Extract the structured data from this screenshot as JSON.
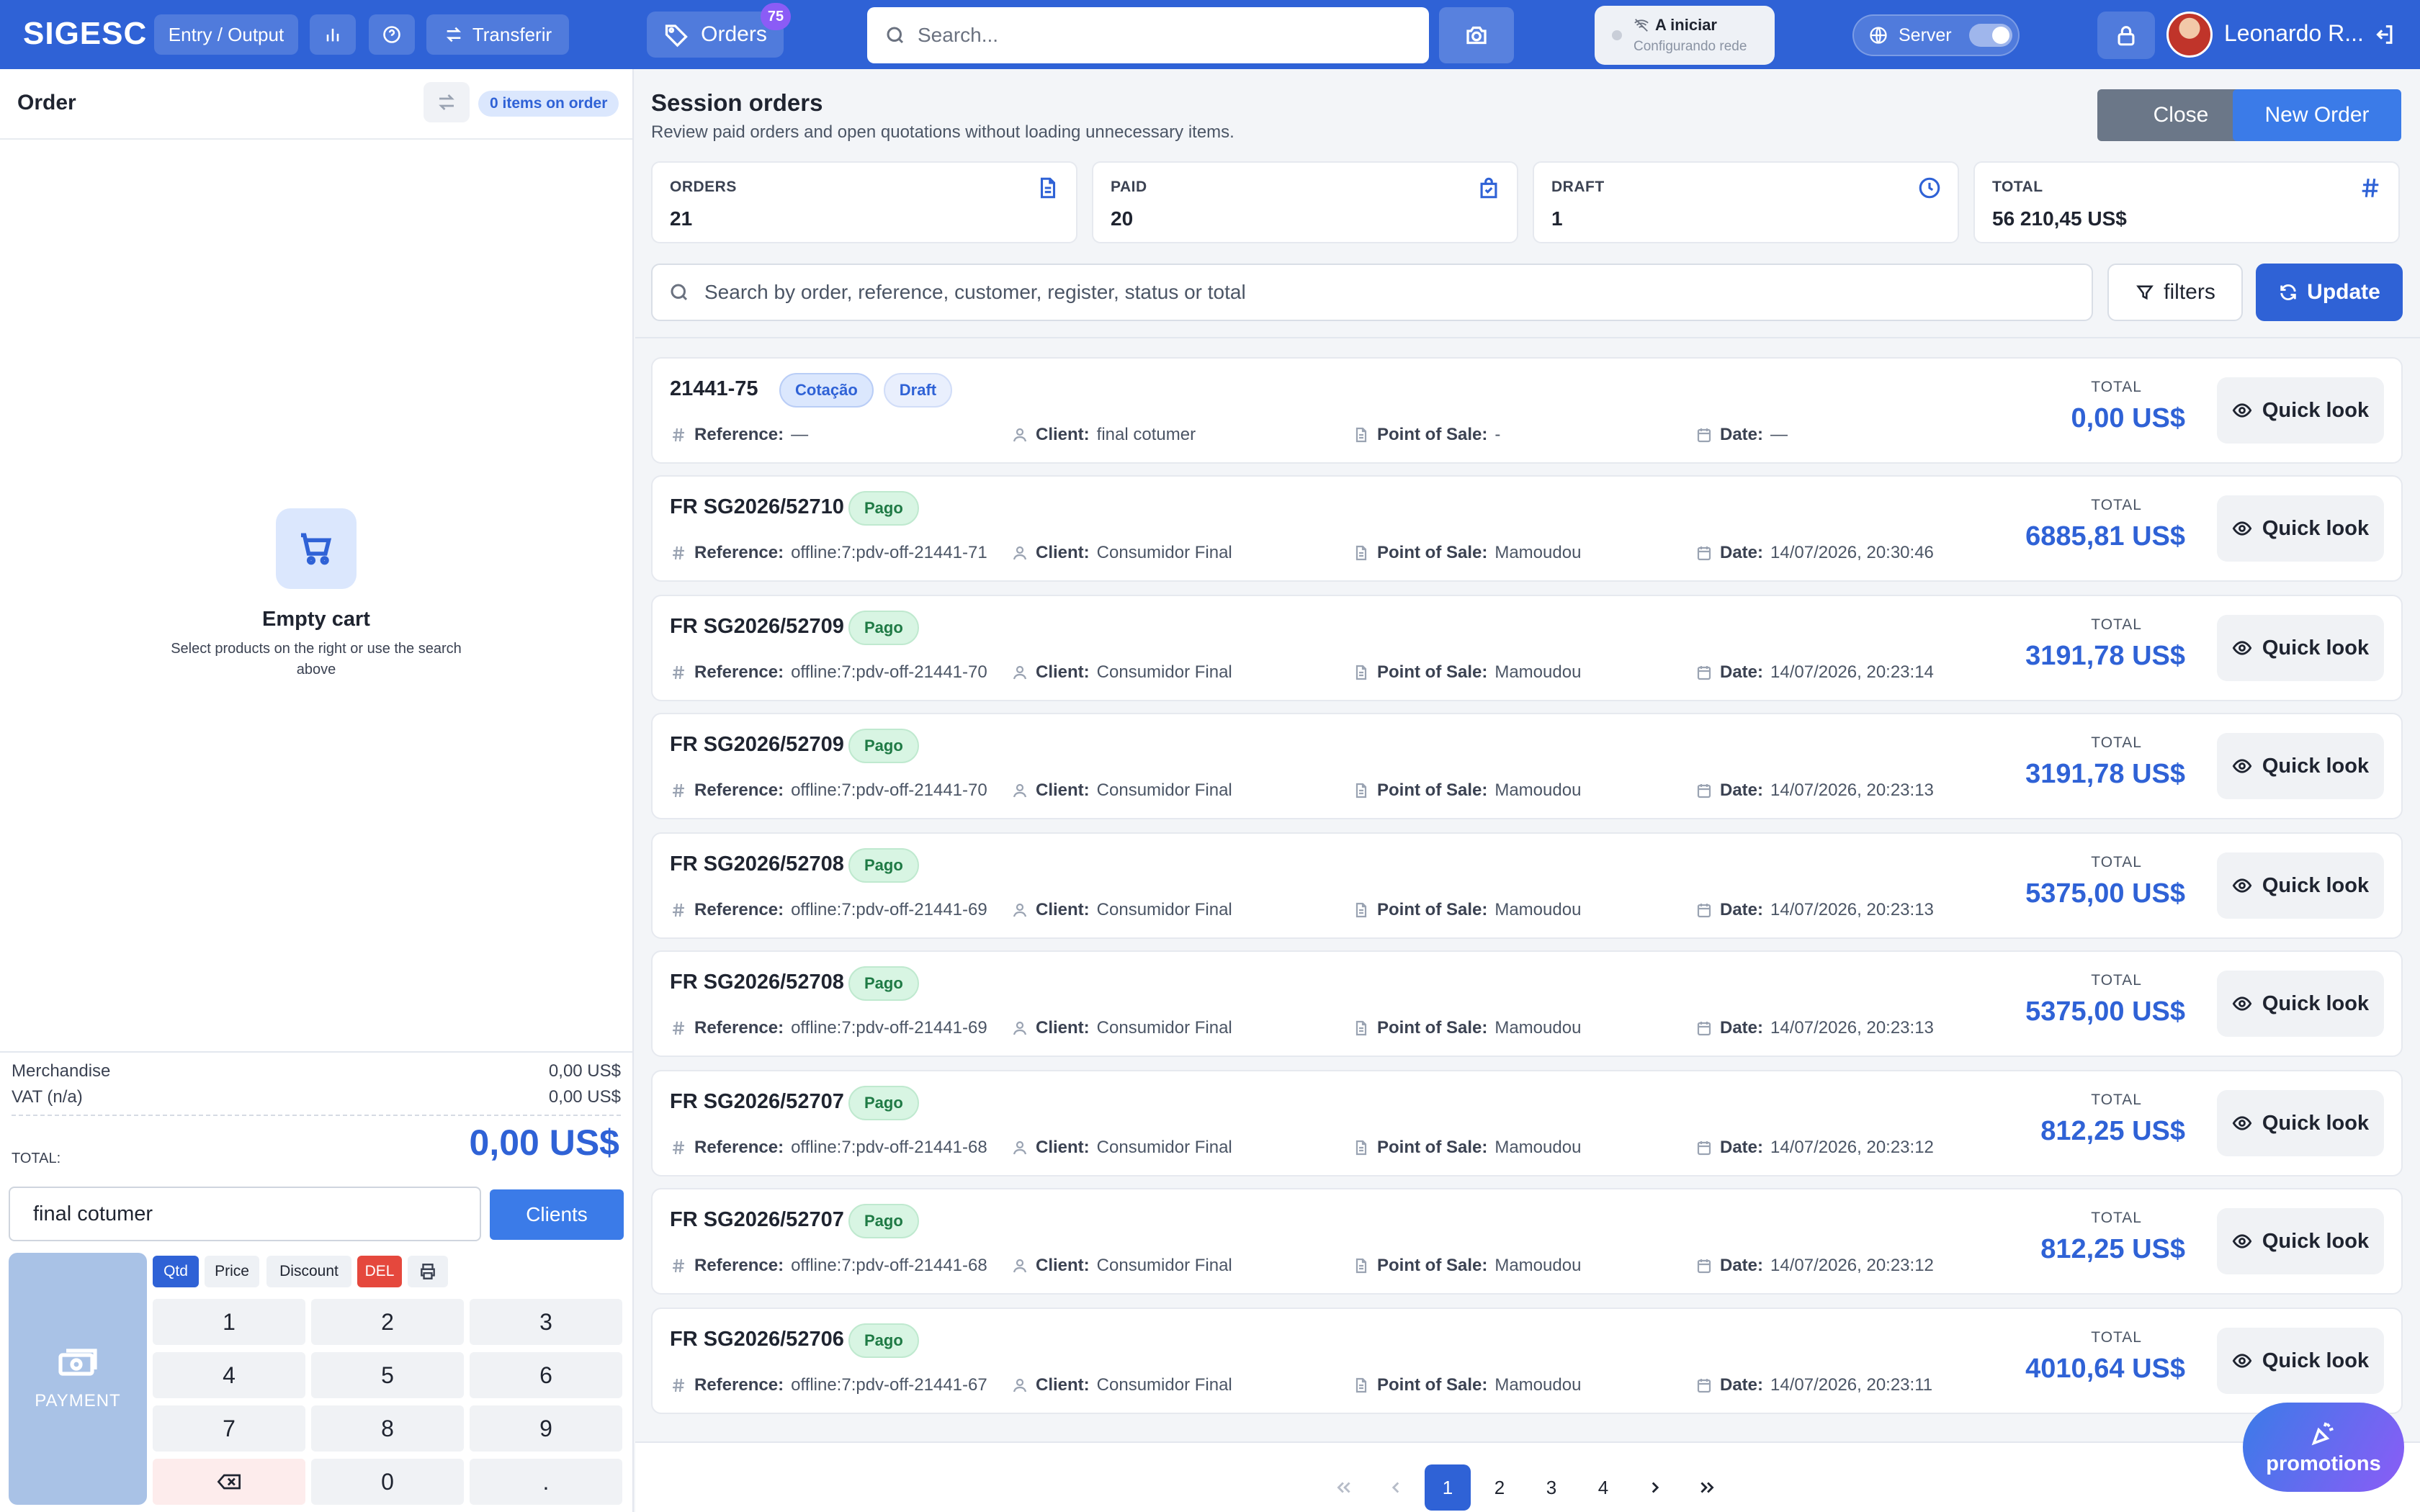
{
  "app": {
    "logo": "SIGESC",
    "nav": {
      "entry_output": "Entry / Output",
      "transfer": "Transferir",
      "orders": "Orders",
      "orders_count": "75"
    },
    "search_placeholder": "Search...",
    "network": {
      "title": "A iniciar",
      "subtitle": "Configurando rede"
    },
    "server_label": "Server",
    "user_name": "Leonardo R..."
  },
  "left": {
    "title": "Order",
    "items_badge": "0 items on order",
    "empty_title": "Empty cart",
    "empty_sub": "Select products on the right or use the search above",
    "merch_label": "Merchandise",
    "merch_value": "0,00 US$",
    "vat_label": "VAT (n/a)",
    "vat_value": "0,00 US$",
    "total_label": "TOTAL:",
    "total_value": "0,00 US$",
    "client_value": "final cotumer",
    "clients_btn": "Clients",
    "payment_label": "PAYMENT",
    "modes": {
      "qtd": "Qtd",
      "price": "Price",
      "discount": "Discount",
      "del": "DEL"
    },
    "keys": [
      "1",
      "2",
      "3",
      "4",
      "5",
      "6",
      "7",
      "8",
      "9",
      "",
      "0",
      "."
    ]
  },
  "main": {
    "title": "Session orders",
    "subtitle": "Review paid orders and open quotations without loading unnecessary items.",
    "close_btn": "Close",
    "new_btn": "New Order",
    "stats": [
      {
        "label": "ORDERS",
        "value": "21",
        "icon": "document-icon"
      },
      {
        "label": "PAID",
        "value": "20",
        "icon": "bag-check-icon"
      },
      {
        "label": "DRAFT",
        "value": "1",
        "icon": "clock-icon"
      },
      {
        "label": "TOTAL",
        "value": "56 210,45 US$",
        "icon": "hash-icon"
      }
    ],
    "filter_placeholder": "Search by order, reference, customer, register, status or total",
    "filters_btn": "filters",
    "update_btn": "Update",
    "ref_label": "Reference:",
    "client_label": "Client:",
    "pos_label": "Point of Sale:",
    "date_label": "Date:",
    "total_label": "TOTAL",
    "quick_label": "Quick look",
    "orders": [
      {
        "id": "21441-75",
        "tags": [
          "Cotação",
          "Draft"
        ],
        "reference": "—",
        "client": "final cotumer",
        "pos": "-",
        "date": "—",
        "total": "0,00 US$"
      },
      {
        "id": "FR SG2026/52710",
        "tags": [
          "Pago"
        ],
        "reference": "offline:7:pdv-off-21441-71",
        "client": "Consumidor Final",
        "pos": "Mamoudou",
        "date": "14/07/2026, 20:30:46",
        "total": "6885,81 US$"
      },
      {
        "id": "FR SG2026/52709",
        "tags": [
          "Pago"
        ],
        "reference": "offline:7:pdv-off-21441-70",
        "client": "Consumidor Final",
        "pos": "Mamoudou",
        "date": "14/07/2026, 20:23:14",
        "total": "3191,78 US$"
      },
      {
        "id": "FR SG2026/52709",
        "tags": [
          "Pago"
        ],
        "reference": "offline:7:pdv-off-21441-70",
        "client": "Consumidor Final",
        "pos": "Mamoudou",
        "date": "14/07/2026, 20:23:13",
        "total": "3191,78 US$"
      },
      {
        "id": "FR SG2026/52708",
        "tags": [
          "Pago"
        ],
        "reference": "offline:7:pdv-off-21441-69",
        "client": "Consumidor Final",
        "pos": "Mamoudou",
        "date": "14/07/2026, 20:23:13",
        "total": "5375,00 US$"
      },
      {
        "id": "FR SG2026/52708",
        "tags": [
          "Pago"
        ],
        "reference": "offline:7:pdv-off-21441-69",
        "client": "Consumidor Final",
        "pos": "Mamoudou",
        "date": "14/07/2026, 20:23:13",
        "total": "5375,00 US$"
      },
      {
        "id": "FR SG2026/52707",
        "tags": [
          "Pago"
        ],
        "reference": "offline:7:pdv-off-21441-68",
        "client": "Consumidor Final",
        "pos": "Mamoudou",
        "date": "14/07/2026, 20:23:12",
        "total": "812,25 US$"
      },
      {
        "id": "FR SG2026/52707",
        "tags": [
          "Pago"
        ],
        "reference": "offline:7:pdv-off-21441-68",
        "client": "Consumidor Final",
        "pos": "Mamoudou",
        "date": "14/07/2026, 20:23:12",
        "total": "812,25 US$"
      },
      {
        "id": "FR SG2026/52706",
        "tags": [
          "Pago"
        ],
        "reference": "offline:7:pdv-off-21441-67",
        "client": "Consumidor Final",
        "pos": "Mamoudou",
        "date": "14/07/2026, 20:23:11",
        "total": "4010,64 US$"
      }
    ],
    "pages": [
      "1",
      "2",
      "3",
      "4"
    ],
    "current_page": "1",
    "promotions_label": "promotions"
  },
  "colors": {
    "brand": "#2f62d6",
    "paid": "#1f7a45",
    "delete": "#e5483d",
    "promo": "#8b5cf6"
  }
}
